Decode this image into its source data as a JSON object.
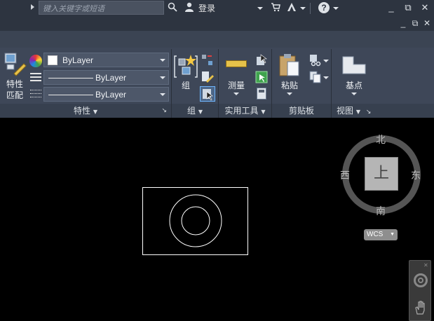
{
  "titlebar": {
    "search_placeholder": "键入关键字或短语",
    "login_label": "登录",
    "icons": [
      "search-icon",
      "user-icon",
      "cart-icon",
      "autodesk-a-icon",
      "help-icon"
    ]
  },
  "window_controls": {
    "minimize": "_",
    "restore": "⧉",
    "close": "✕"
  },
  "ribbon": {
    "properties": {
      "match_label_line1": "特性",
      "match_label_line2": "匹配",
      "color_value": "ByLayer",
      "linetype_value": "ByLayer",
      "lineweight_value": "ByLayer",
      "footer": "特性"
    },
    "groups": {
      "group_label": "组",
      "footer": "组"
    },
    "utilities": {
      "measure_label": "测量",
      "footer": "实用工具"
    },
    "clipboard": {
      "paste_label": "粘贴",
      "footer": "剪贴板"
    },
    "view": {
      "basepoint_label": "基点",
      "footer": "视图"
    }
  },
  "viewcube": {
    "north": "北",
    "south": "南",
    "east": "东",
    "west": "西",
    "face": "上",
    "wcs_label": "WCS"
  },
  "colors": {
    "ribbon_bg": "#3e4758",
    "canvas_bg": "#000000",
    "drawing_stroke": "#ffffff"
  }
}
